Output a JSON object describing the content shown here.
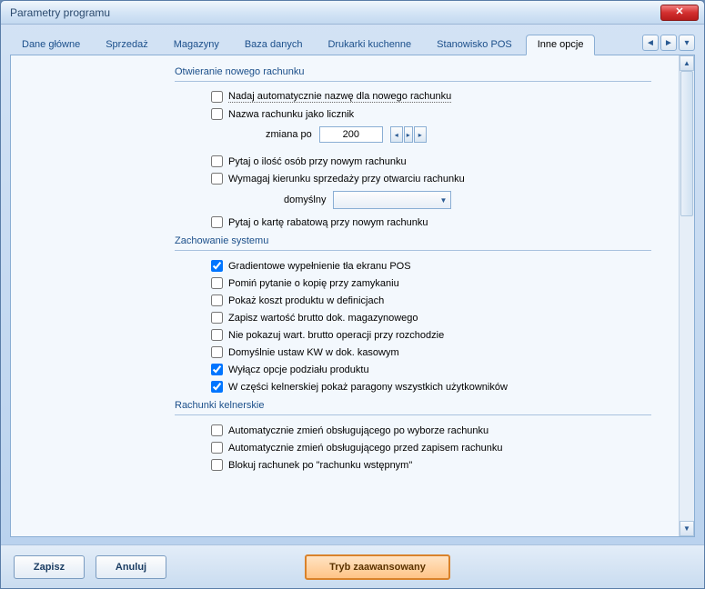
{
  "window": {
    "title": "Parametry programu"
  },
  "tabs": [
    {
      "label": "Dane główne"
    },
    {
      "label": "Sprzedaż"
    },
    {
      "label": "Magazyny"
    },
    {
      "label": "Baza danych"
    },
    {
      "label": "Drukarki kuchenne"
    },
    {
      "label": "Stanowisko POS"
    },
    {
      "label": "Inne opcje",
      "active": true
    }
  ],
  "groups": {
    "open": {
      "title": "Otwieranie nowego rachunku",
      "autoName": {
        "checked": false,
        "label": "Nadaj automatycznie nazwę dla nowego rachunku"
      },
      "counter": {
        "checked": false,
        "label": "Nazwa rachunku jako licznik"
      },
      "zmiana": {
        "label": "zmiana po",
        "value": "200"
      },
      "askQty": {
        "checked": false,
        "label": "Pytaj o ilość osób przy nowym rachunku"
      },
      "reqDir": {
        "checked": false,
        "label": "Wymagaj kierunku sprzedaży przy otwarciu rachunku"
      },
      "default": {
        "label": "domyślny",
        "value": ""
      },
      "askCard": {
        "checked": false,
        "label": "Pytaj o kartę rabatową przy nowym rachunku"
      }
    },
    "system": {
      "title": "Zachowanie systemu",
      "gradient": {
        "checked": true,
        "label": "Gradientowe wypełnienie tła ekranu POS"
      },
      "skipCopy": {
        "checked": false,
        "label": "Pomiń pytanie o kopię przy zamykaniu"
      },
      "showCost": {
        "checked": false,
        "label": "Pokaż koszt produktu w definicjach"
      },
      "saveBrutto": {
        "checked": false,
        "label": "Zapisz wartość brutto dok. magazynowego"
      },
      "hideBrutto": {
        "checked": false,
        "label": "Nie pokazuj wart. brutto operacji  przy rozchodzie"
      },
      "kwDefault": {
        "checked": false,
        "label": "Domyślnie ustaw KW w dok. kasowym"
      },
      "disableSplit": {
        "checked": true,
        "label": "Wyłącz opcje podziału produktu"
      },
      "waiterReceipts": {
        "checked": true,
        "label": "W części kelnerskiej pokaż paragony wszystkich użytkowników"
      }
    },
    "waiter": {
      "title": "Rachunki kelnerskie",
      "changeAfter": {
        "checked": false,
        "label": "Automatycznie zmień obsługującego po wyborze rachunku"
      },
      "changeBefore": {
        "checked": false,
        "label": "Automatycznie zmień obsługującego przed zapisem rachunku"
      },
      "block": {
        "checked": false,
        "label": "Blokuj rachunek po \"rachunku wstępnym\""
      }
    }
  },
  "footer": {
    "save": "Zapisz",
    "cancel": "Anuluj",
    "advanced": "Tryb zaawansowany"
  }
}
